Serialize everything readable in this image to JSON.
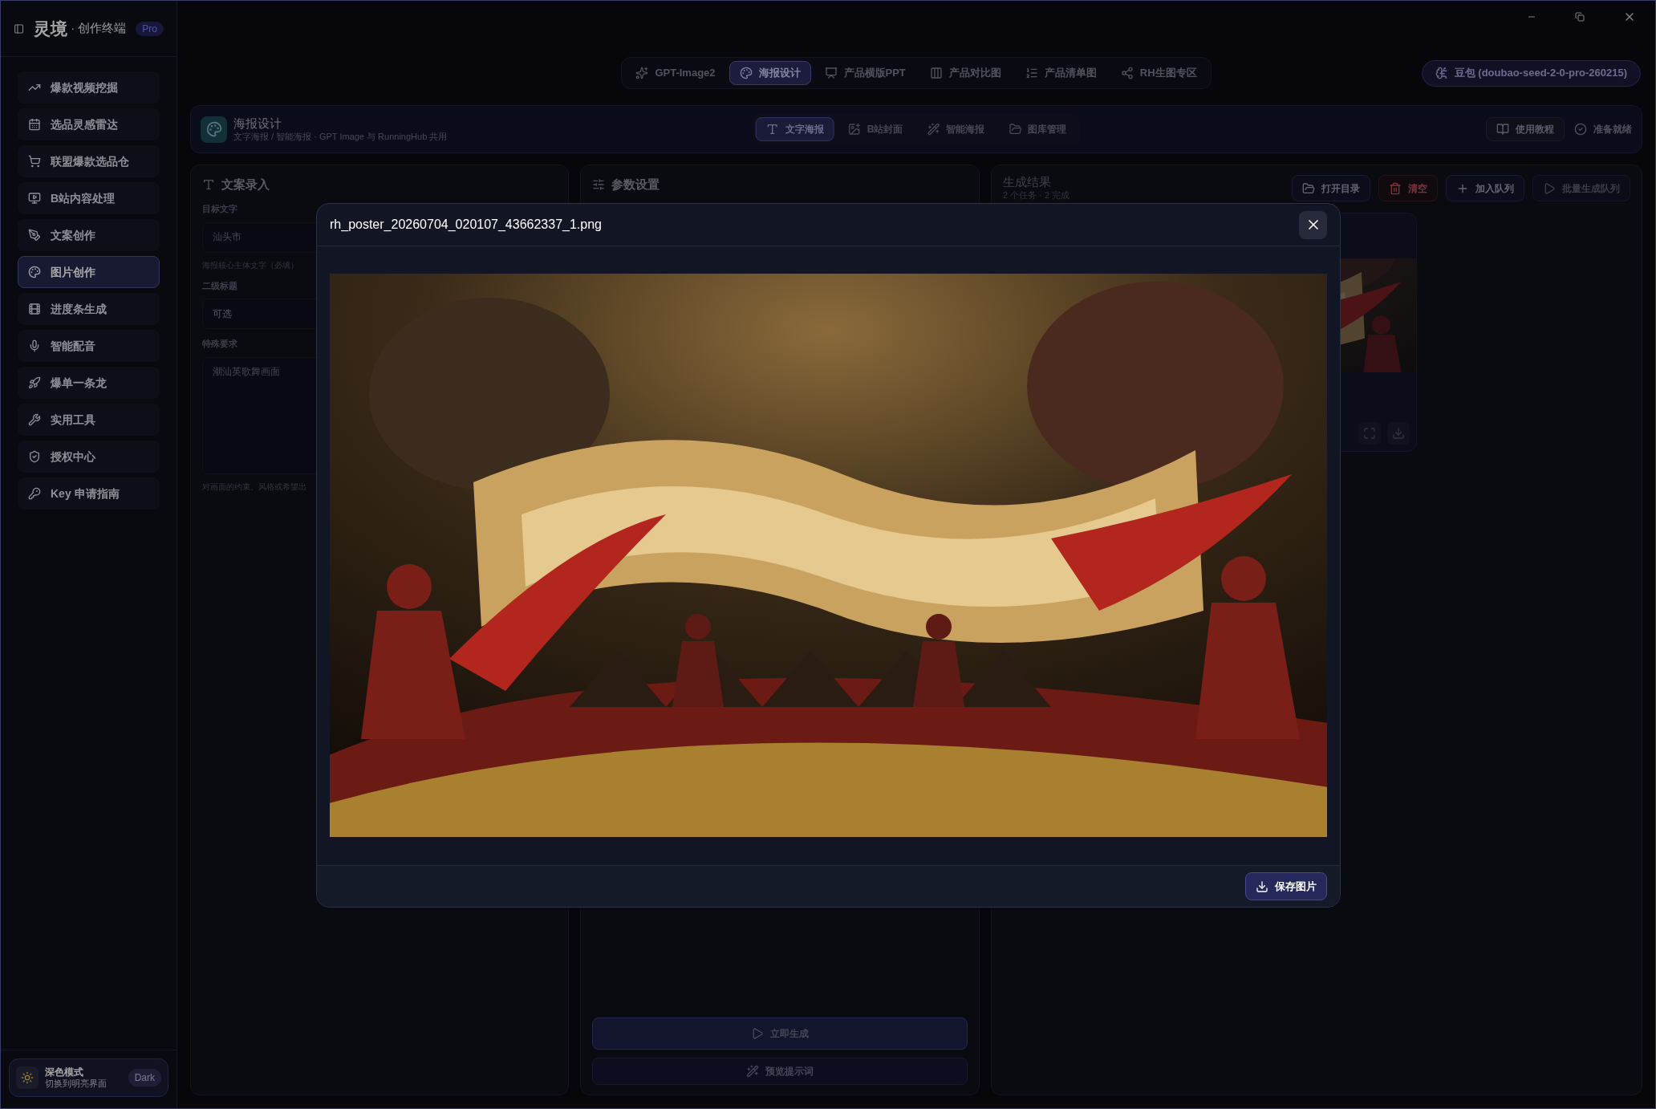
{
  "app": {
    "name": "灵境",
    "subtitle": "· 创作终端",
    "badge": "Pro"
  },
  "sidebar": {
    "items": [
      {
        "label": "爆款视频挖掘",
        "selected": false
      },
      {
        "label": "选品灵感雷达",
        "selected": false
      },
      {
        "label": "联盟爆款选品仓",
        "selected": false
      },
      {
        "label": "B站内容处理",
        "selected": false
      },
      {
        "label": "文案创作",
        "selected": false
      },
      {
        "label": "图片创作",
        "selected": true
      },
      {
        "label": "进度条生成",
        "selected": false
      },
      {
        "label": "智能配音",
        "selected": false
      },
      {
        "label": "爆单一条龙",
        "selected": false
      },
      {
        "label": "实用工具",
        "selected": false
      },
      {
        "label": "授权中心",
        "selected": false
      },
      {
        "label": "Key 申请指南",
        "selected": false
      }
    ],
    "theme": {
      "title": "深色模式",
      "hint": "切换到明亮界面",
      "badge": "Dark"
    }
  },
  "top_tabs": [
    {
      "label": "GPT-Image2",
      "selected": false
    },
    {
      "label": "海报设计",
      "selected": true
    },
    {
      "label": "产品横版PPT",
      "selected": false
    },
    {
      "label": "产品对比图",
      "selected": false
    },
    {
      "label": "产品清单图",
      "selected": false
    },
    {
      "label": "RH生图专区",
      "selected": false
    }
  ],
  "model": "豆包 (doubao-seed-2-0-pro-260215)",
  "section": {
    "title": "海报设计",
    "subtitle": "文字海报 / 智能海报 · GPT Image 与 RunningHub 共用",
    "tabs": [
      {
        "label": "文字海报",
        "selected": true
      },
      {
        "label": "B站封面",
        "selected": false
      },
      {
        "label": "智能海报",
        "selected": false
      },
      {
        "label": "图库管理",
        "selected": false
      }
    ],
    "help": "使用教程",
    "status": "准备就绪"
  },
  "copy_panel": {
    "title": "文案录入",
    "fields": [
      {
        "label": "目标文字",
        "value": "汕头市",
        "hint": "海报核心主体文字（必填）"
      },
      {
        "label": "二级标题",
        "placeholder": "可选"
      },
      {
        "label": "特殊要求",
        "value": "潮汕英歌舞画面",
        "hint": "对画面的约束、风格或希望出"
      }
    ]
  },
  "params_panel": {
    "title": "参数设置",
    "buttons": [
      {
        "label": "立即生成",
        "kind": "primary"
      },
      {
        "label": "预览提示词",
        "kind": "secondary"
      }
    ]
  },
  "results_panel": {
    "title": "生成结果",
    "summary": "2 个任务 · 2 完成",
    "buttons": [
      {
        "label": "打开目录",
        "kind": "normal",
        "disabled": false
      },
      {
        "label": "清空",
        "kind": "danger",
        "disabled": false
      },
      {
        "label": "加入队列",
        "kind": "normal",
        "disabled": false
      },
      {
        "label": "批量生成队列",
        "kind": "normal",
        "disabled": true
      }
    ]
  },
  "preview": {
    "title": "rh_poster_20260704_020107_43662337_1.png",
    "save": "保存图片"
  }
}
